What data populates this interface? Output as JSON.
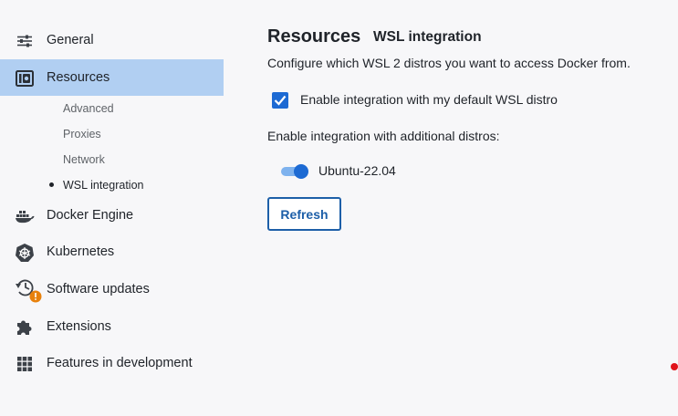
{
  "sidebar": {
    "general": {
      "label": "General",
      "icon": "sliders-icon"
    },
    "resources": {
      "label": "Resources",
      "icon": "resources-icon"
    },
    "resources_sub": {
      "advanced": "Advanced",
      "proxies": "Proxies",
      "network": "Network",
      "wsl": "WSL integration"
    },
    "docker_engine": {
      "label": "Docker Engine",
      "icon": "whale-icon"
    },
    "kubernetes": {
      "label": "Kubernetes",
      "icon": "helm-icon"
    },
    "software_updates": {
      "label": "Software updates",
      "icon": "history-icon",
      "badge_icon": "warning-badge-icon"
    },
    "extensions": {
      "label": "Extensions",
      "icon": "puzzle-icon"
    },
    "features": {
      "label": "Features in development",
      "icon": "grid-icon"
    },
    "selected_color": "#b1cff2"
  },
  "main": {
    "title": "Resources",
    "subtitle": "WSL integration",
    "description": "Configure which WSL 2 distros you want to access Docker from.",
    "default_distro": {
      "label": "Enable integration with my default WSL distro",
      "checked": true
    },
    "additional_label": "Enable integration with additional distros:",
    "distros": [
      {
        "name": "Ubuntu-22.04",
        "enabled": true
      }
    ],
    "refresh_button": "Refresh"
  },
  "colors": {
    "accent": "#1d6ad3",
    "button_border": "#1d5fa8",
    "warning": "#e8810c"
  }
}
